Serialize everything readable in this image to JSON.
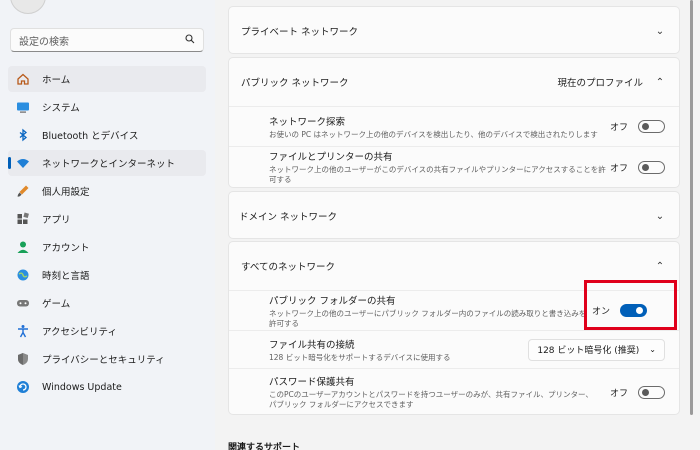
{
  "search": {
    "placeholder": "設定の検索"
  },
  "nav": {
    "items": [
      {
        "label": "ホーム",
        "icon": "home-icon"
      },
      {
        "label": "システム",
        "icon": "system-icon"
      },
      {
        "label": "Bluetooth とデバイス",
        "icon": "bluetooth-icon"
      },
      {
        "label": "ネットワークとインターネット",
        "icon": "wifi-icon"
      },
      {
        "label": "個人用設定",
        "icon": "brush-icon"
      },
      {
        "label": "アプリ",
        "icon": "apps-icon"
      },
      {
        "label": "アカウント",
        "icon": "account-icon"
      },
      {
        "label": "時刻と言語",
        "icon": "globe-clock-icon"
      },
      {
        "label": "ゲーム",
        "icon": "gamepad-icon"
      },
      {
        "label": "アクセシビリティ",
        "icon": "accessibility-icon"
      },
      {
        "label": "プライバシーとセキュリティ",
        "icon": "shield-icon"
      },
      {
        "label": "Windows Update",
        "icon": "update-icon"
      }
    ]
  },
  "private_network": {
    "title": "プライベート ネットワーク"
  },
  "public_network": {
    "title": "パブリック ネットワーク",
    "extra": "現在のプロファイル",
    "rows": [
      {
        "title": "ネットワーク探索",
        "desc": "お使いの PC はネットワーク上の他のデバイスを検出したり、他のデバイスで検出されたりします",
        "state": "オフ"
      },
      {
        "title": "ファイルとプリンターの共有",
        "desc": "ネットワーク上の他のユーザーがこのデバイスの共有ファイルやプリンターにアクセスすることを許可する",
        "state": "オフ"
      }
    ]
  },
  "domain_network": {
    "title": "ドメイン ネットワーク"
  },
  "all_networks": {
    "title": "すべてのネットワーク",
    "public_folder": {
      "title": "パブリック フォルダーの共有",
      "desc": "ネットワーク上の他のユーザーにパブリック フォルダー内のファイルの読み取りと書き込みを許可する",
      "state": "オン"
    },
    "file_sharing": {
      "title": "ファイル共有の接続",
      "desc": "128 ビット暗号化をサポートするデバイスに使用する",
      "value": "128 ビット暗号化 (推奨)"
    },
    "password_sharing": {
      "title": "パスワード保護共有",
      "desc": "このPCのユーザーアカウントとパスワードを持つユーザーのみが、共有ファイル、プリンター、パブリック フォルダーにアクセスできます",
      "state": "オフ"
    }
  },
  "related_support": "関連するサポート",
  "colors": {
    "accent": "#005fb8",
    "highlight": "#e0001b"
  }
}
